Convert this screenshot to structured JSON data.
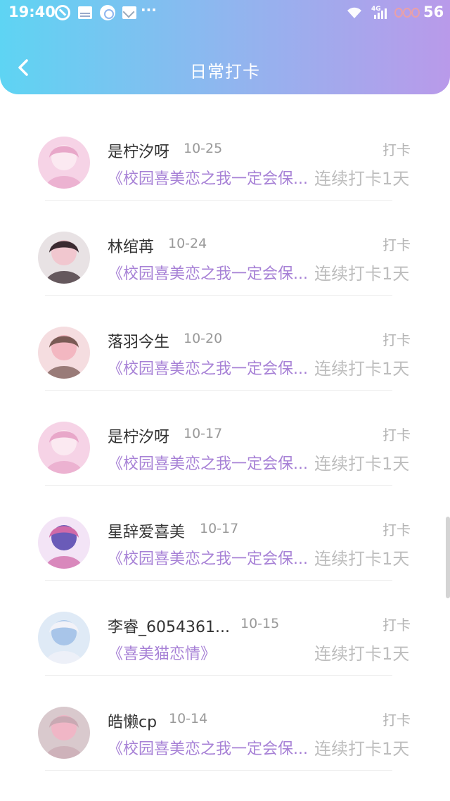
{
  "status_bar": {
    "time": "19:40",
    "more": "···",
    "network": "4G",
    "battery": "56"
  },
  "header": {
    "title": "日常打卡",
    "back_icon": "chevron-left-icon"
  },
  "colors": {
    "header_gradient_start": "#5ed4f3",
    "header_gradient_end": "#b99aea",
    "work_link": "#a781d6",
    "muted_text": "#bdbdbd"
  },
  "items": [
    {
      "name": "是柠汐呀",
      "date": "10-25",
      "action": "打卡",
      "work": "《校园喜美恋之我一定会保...",
      "streak": "连续打卡1天"
    },
    {
      "name": "林绾苒",
      "date": "10-24",
      "action": "打卡",
      "work": "《校园喜美恋之我一定会保...",
      "streak": "连续打卡1天"
    },
    {
      "name": "落羽今生",
      "date": "10-20",
      "action": "打卡",
      "work": "《校园喜美恋之我一定会保...",
      "streak": "连续打卡1天"
    },
    {
      "name": "是柠汐呀",
      "date": "10-17",
      "action": "打卡",
      "work": "《校园喜美恋之我一定会保...",
      "streak": "连续打卡1天"
    },
    {
      "name": "星辞爱喜美",
      "date": "10-17",
      "action": "打卡",
      "work": "《校园喜美恋之我一定会保...",
      "streak": "连续打卡1天"
    },
    {
      "name": "李睿_6054361...",
      "date": "10-15",
      "action": "打卡",
      "work": "《喜美猫恋情》",
      "streak": "连续打卡1天"
    },
    {
      "name": "皓懒cp",
      "date": "10-14",
      "action": "打卡",
      "work": "《校园喜美恋之我一定会保...",
      "streak": "连续打卡1天"
    }
  ]
}
